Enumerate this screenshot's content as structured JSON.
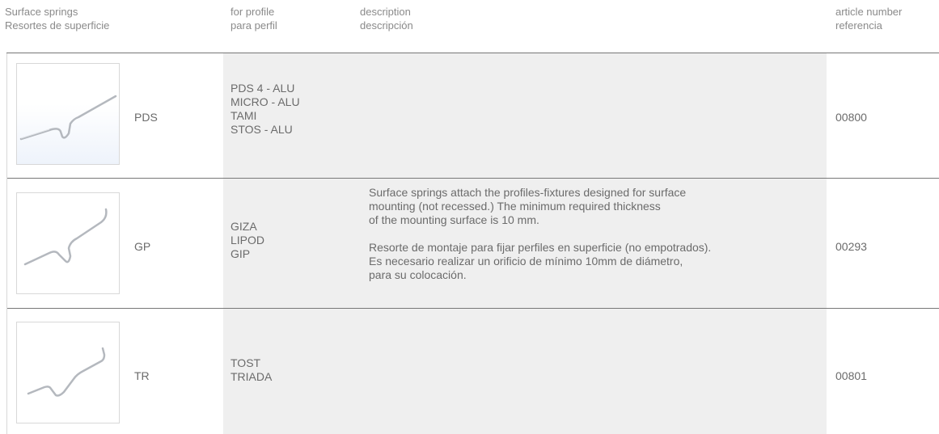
{
  "header": {
    "type_en": "Surface springs",
    "type_es": "Resortes de superficie",
    "profile_en": "for profile",
    "profile_es": "para perfil",
    "desc_en": "description",
    "desc_es": "descripción",
    "article_en": "article number",
    "article_es": "referencia"
  },
  "rows": [
    {
      "code": "PDS",
      "profiles": [
        "PDS 4 - ALU",
        "MICRO - ALU",
        "TAMI",
        "STOS - ALU"
      ],
      "article": "00800"
    },
    {
      "code": "GP",
      "profiles": [
        "GIZA",
        "LIPOD",
        "GIP"
      ],
      "article": "00293"
    },
    {
      "code": "TR",
      "profiles": [
        "TOST",
        "TRIADA"
      ],
      "article": "00801"
    }
  ],
  "description": {
    "en": [
      "Surface springs attach the profiles-fixtures designed for surface",
      "mounting (not recessed.) The minimum required thickness",
      "of the mounting surface is 10 mm."
    ],
    "es": [
      "Resorte de montaje para fijar perfiles en superficie (no empotrados).",
      "Es necesario realizar un orificio de mínimo 10mm de diámetro,",
      "para su colocación."
    ]
  },
  "colors": {
    "column_bg": "#efefef",
    "text": "#6b6b6b",
    "rule": "#777777"
  }
}
